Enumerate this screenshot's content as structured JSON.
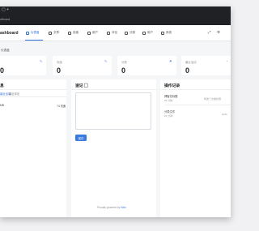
{
  "browser": {
    "tab_glyphs": "▢ +",
    "address": "ofboard"
  },
  "app": {
    "brand": "ashboard"
  },
  "nav": [
    {
      "label": "仪表盘",
      "icon": "home-icon"
    },
    {
      "label": "文章",
      "icon": "document-icon"
    },
    {
      "label": "页面",
      "icon": "page-icon"
    },
    {
      "label": "用户",
      "icon": "users-icon"
    },
    {
      "label": "评论",
      "icon": "comment-icon"
    },
    {
      "label": "分类",
      "icon": "folder-icon"
    },
    {
      "label": "用户",
      "icon": "user-icon"
    },
    {
      "label": "系统",
      "icon": "gear-icon"
    }
  ],
  "toolbar": {
    "icon_a": "⤢",
    "icon_b": "⚙"
  },
  "breadcrumb": "仪表盘",
  "stats": [
    {
      "label": "",
      "value": "0",
      "icon": "✎"
    },
    {
      "label": "页面",
      "value": "0",
      "icon": "✎"
    },
    {
      "label": "分类",
      "value": "0",
      "icon": "⚑"
    },
    {
      "label": "最近活动",
      "value": "0",
      "icon": "◔"
    }
  ],
  "left_panel": {
    "title": "息",
    "tabs": [
      "最近活动",
      "最近评论"
    ],
    "row_label": "MB",
    "row_value": "74 页面"
  },
  "notes_panel": {
    "title": "速记 ▢",
    "note_placeholder": "",
    "save_label": "保存"
  },
  "activity_panel": {
    "title": "操作记录",
    "entries": [
      {
        "title": "博客总标题",
        "meta": "26 分钟",
        "detail": "修改了文章标题"
      },
      {
        "title": "分类文件",
        "meta": "26 分钟",
        "detail": "Hello"
      }
    ]
  },
  "footer": {
    "text": "Proudly powered by ",
    "link": "Halo"
  }
}
